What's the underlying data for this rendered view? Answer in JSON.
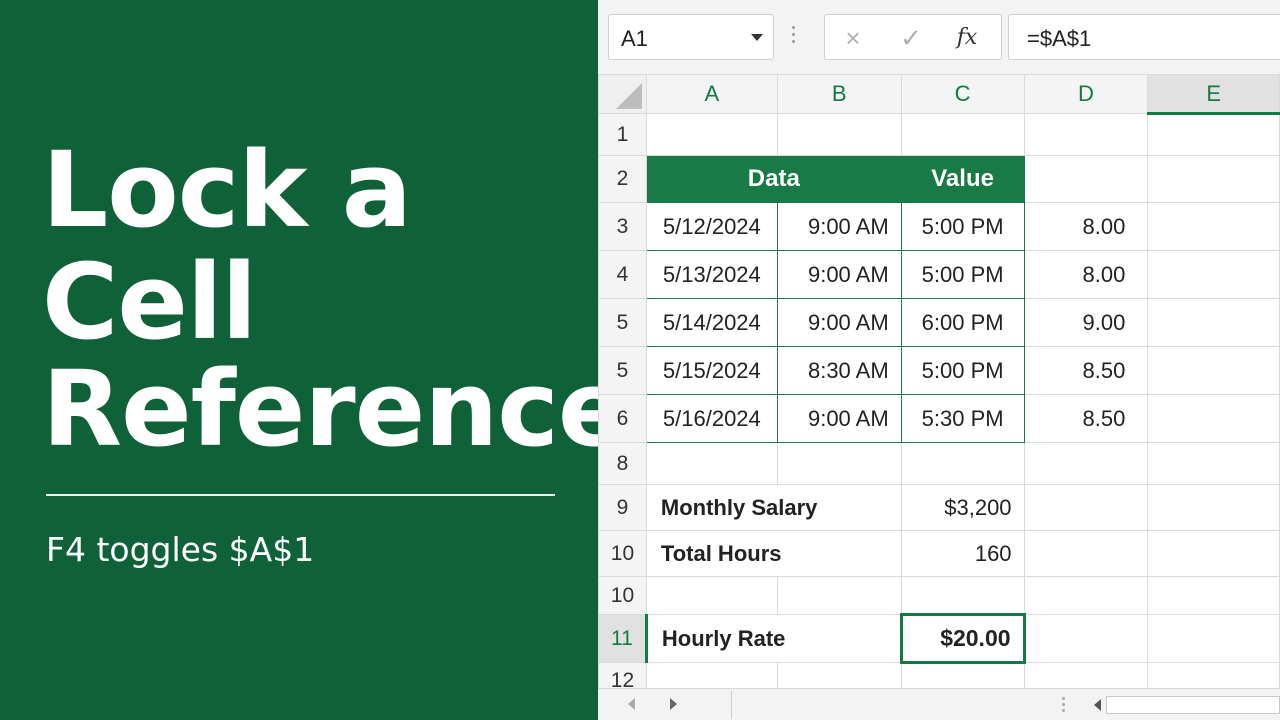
{
  "title": {
    "line1": "Lock a",
    "line2": "Cell",
    "line3": "Reference",
    "subtitle": "F4 toggles $A$1"
  },
  "formula_bar": {
    "name_box": "A1",
    "cancel_icon": "×",
    "enter_icon": "✓",
    "fx_label": "fx",
    "formula": "=$A$1"
  },
  "columns": [
    "A",
    "B",
    "C",
    "D",
    "E"
  ],
  "selected_column": "E",
  "rows": {
    "r1": "1",
    "r2": "2",
    "r3": "3",
    "r4": "4",
    "r5": "5",
    "r6": "5",
    "r7": "6",
    "r8": "8",
    "r9": "9",
    "r10": "10",
    "r11": "10",
    "r12": "11",
    "r13": "12"
  },
  "selected_row": "11",
  "table": {
    "header_data": "Data",
    "header_value": "Value",
    "rows": [
      {
        "date": "5/12/2024",
        "start": "9:00 AM",
        "end": "5:00 PM",
        "hours": "8.00"
      },
      {
        "date": "5/13/2024",
        "start": "9:00 AM",
        "end": "5:00 PM",
        "hours": "8.00"
      },
      {
        "date": "5/14/2024",
        "start": "9:00 AM",
        "end": "6:00 PM",
        "hours": "9.00"
      },
      {
        "date": "5/15/2024",
        "start": "8:30 AM",
        "end": "5:00 PM",
        "hours": "8.50"
      },
      {
        "date": "5/16/2024",
        "start": "9:00 AM",
        "end": "5:30 PM",
        "hours": "8.50"
      }
    ]
  },
  "summary": {
    "salary_label": "Monthly Salary",
    "salary_value": "$3,200",
    "hours_label": "Total Hours",
    "hours_value": "160",
    "rate_label": "Hourly Rate",
    "rate_value": "$20.00"
  },
  "colors": {
    "panel_green": "#0f6138",
    "header_green": "#187a44",
    "accent": "#107c41"
  }
}
